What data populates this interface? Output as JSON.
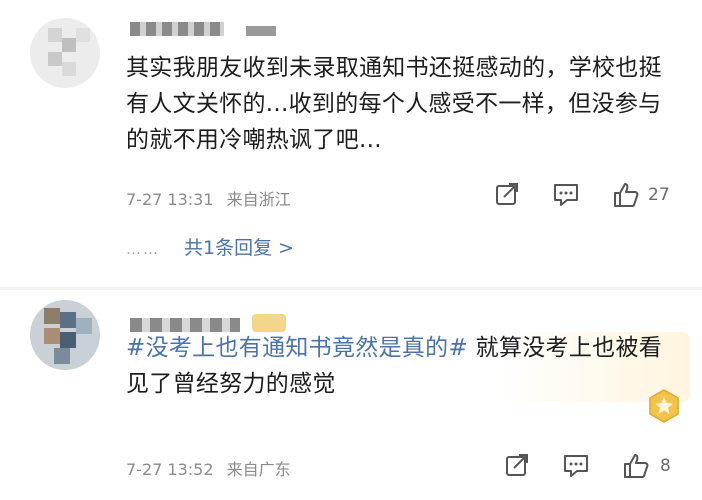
{
  "comments": [
    {
      "text": "其实我朋友收到未录取通知书还挺感动的，学校也挺有人文关怀的...收到的每个人感受不一样，但没参与的就不用冷嘲热讽了吧...",
      "time": "7-27 13:31",
      "location": "来自浙江",
      "likes": "27",
      "icons": [
        "share-icon",
        "comment-icon",
        "like-icon"
      ]
    },
    {
      "hashtag": "#没考上也有通知书竟然是真的#",
      "text": " 就算没考上也被看见了曾经努力的感觉",
      "time": "7-27 13:52",
      "location": "来自广东",
      "likes": "8",
      "icons": [
        "share-icon",
        "comment-icon",
        "like-icon"
      ]
    }
  ],
  "replies": {
    "dots": "……",
    "label": "共1条回复 >"
  },
  "colors": {
    "link": "#4b73a8",
    "meta": "#8a8a8a",
    "badge": "#f3c34a"
  }
}
